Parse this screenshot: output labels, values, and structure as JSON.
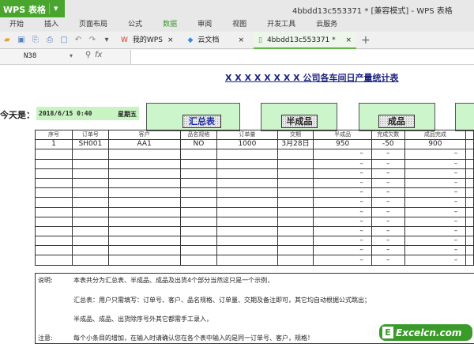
{
  "app": {
    "name": "WPS 表格",
    "window_title": "4bbdd13c553371 * [兼容模式] - WPS 表格"
  },
  "menu": [
    "开始",
    "插入",
    "页面布局",
    "公式",
    "数据",
    "审阅",
    "视图",
    "开发工具",
    "云服务"
  ],
  "menu_active": "数据",
  "tabs": [
    {
      "label": "我的WPS"
    },
    {
      "label": "云文档"
    },
    {
      "label": "4bbdd13c553371 *"
    }
  ],
  "formula": {
    "cell": "N38",
    "fx": "fx",
    "value": ""
  },
  "sheet": {
    "title": "X X X X X X X X 公司各车间日产量统计表",
    "today_label": "今天是：",
    "date": "2018/6/15 0:40",
    "weekday": "星期五",
    "buttons": [
      "汇总表",
      "半成品",
      "成品"
    ],
    "headers": [
      "序号",
      "订单号",
      "客户",
      "品名规格",
      "订单量",
      "交期",
      "半成品",
      "完成欠数",
      "成品完成",
      ""
    ],
    "row1": [
      "1",
      "SH001",
      "AA1",
      "NO",
      "1000",
      "3月28日",
      "950",
      "-50",
      "900",
      ""
    ],
    "dash": "–",
    "notes": {
      "label1": "说明:",
      "line1": "本表共分为汇总表、半成品、成品及出货4个部分当然这只是一个示例，",
      "line2": "汇总表：用户只需填写：订单号、客户、品名规格、订单量、交期及备注即可，其它均自动根据公式跳出；",
      "line3": "半成品、成品、出货除序号外其它都需手工录入，",
      "label2": "注意:",
      "line4": "每个小条目的增加，在输入时请确认您在各个表中输入的是同一订单号、客户，规格！"
    }
  },
  "watermark": "Excelcn.com"
}
